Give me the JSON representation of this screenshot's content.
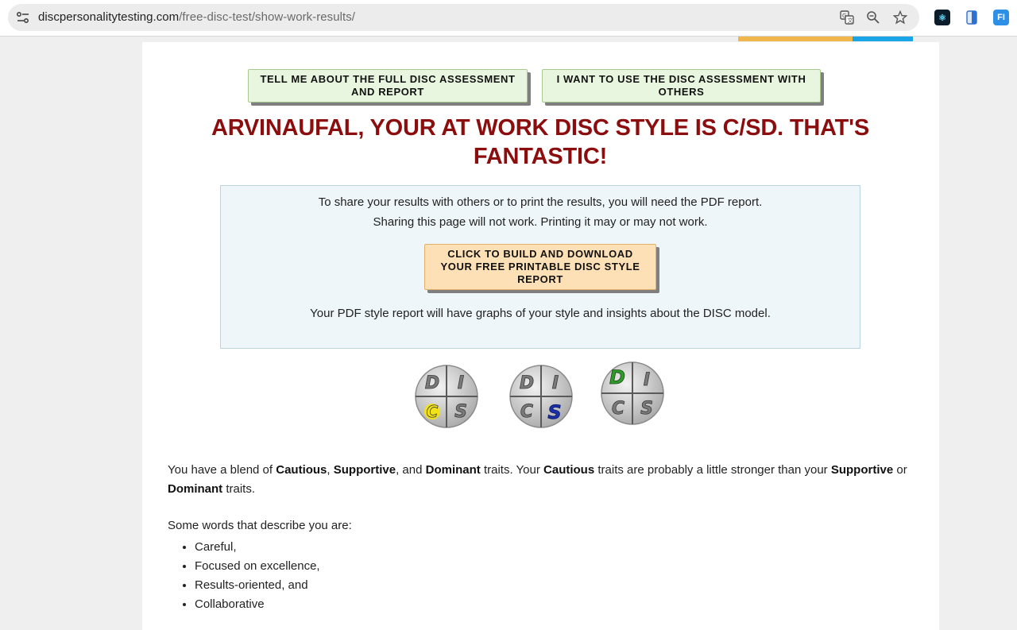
{
  "browser": {
    "url_host": "discpersonalitytesting.com",
    "url_path": "/free-disc-test/show-work-results/",
    "site_info_icon": "tune-icon",
    "omnibox_icons": [
      "translate-icon",
      "zoom-icon",
      "bookmark-star-icon"
    ],
    "extensions": [
      {
        "name": "react-devtools-icon",
        "glyph": "⚛",
        "color": "#0b1d2a"
      },
      {
        "name": "document-extension-icon",
        "glyph": "▮",
        "color": "#2f6fd0"
      },
      {
        "name": "fi-extension-icon",
        "glyph": "FI",
        "color": "#2d8fe6"
      }
    ]
  },
  "buttons": {
    "full_assessment": "TELL ME ABOUT THE FULL DISC ASSESSMENT AND REPORT",
    "use_with_others": "I WANT TO USE THE DISC ASSESSMENT WITH OTHERS",
    "download_report": "CLICK TO BUILD AND DOWNLOAD YOUR FREE PRINTABLE DISC STYLE REPORT"
  },
  "headline": "ARVINAUFAL, YOUR AT WORK DISC STYLE IS C/SD. THAT'S FANTASTIC!",
  "notice": {
    "line1": "To share your results with others or to print the results, you will need the PDF report.",
    "line2": "Sharing this page will not work. Printing it may or may not work.",
    "footer": "Your PDF style report will have graphs of your style and insights about the DISC model."
  },
  "disc_icons": [
    {
      "highlight": "C",
      "highlight_color": "#f2e21a"
    },
    {
      "highlight": "S",
      "highlight_color": "#1a2fa8"
    },
    {
      "highlight": "D",
      "highlight_color": "#2e9a2a"
    }
  ],
  "description": {
    "p1_a": "You have a blend of ",
    "trait1": "Cautious",
    "p1_b": ", ",
    "trait2": "Supportive",
    "p1_c": ", and ",
    "trait3": "Dominant",
    "p1_d": " traits. Your ",
    "trait4": "Cautious",
    "p1_e": " traits are probably a little stronger than your ",
    "trait5": "Supportive",
    "p1_f": " or ",
    "trait6": "Dominant",
    "p1_g": " traits."
  },
  "words_intro": "Some words that describe you are:",
  "words": [
    "Careful,",
    "Focused on excellence,",
    "Results-oriented, and",
    "Collaborative"
  ]
}
